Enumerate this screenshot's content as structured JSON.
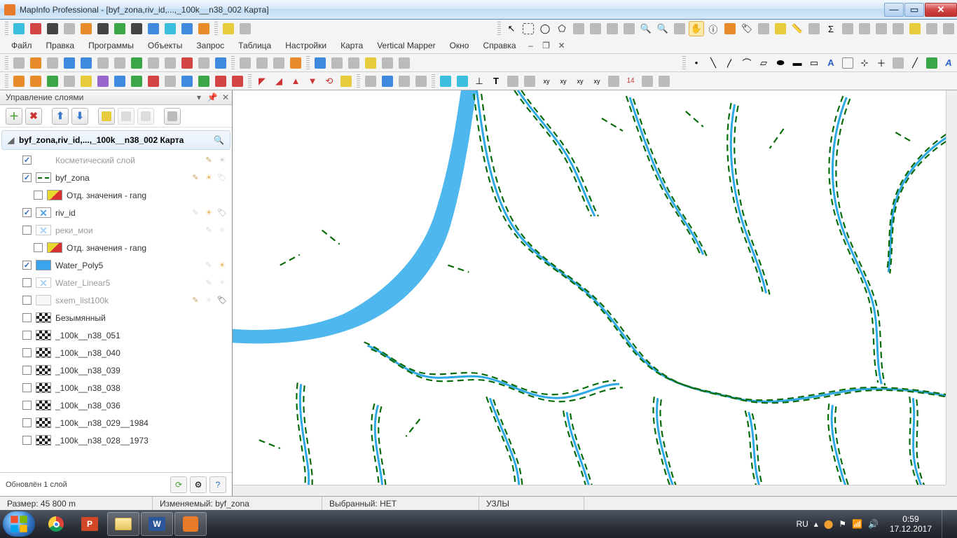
{
  "title": "MapInfo Professional - [byf_zona,riv_id,...,_100k__n38_002 Карта]",
  "menu": [
    "Файл",
    "Правка",
    "Программы",
    "Объекты",
    "Запрос",
    "Таблица",
    "Настройки",
    "Карта",
    "Vertical Mapper",
    "Окно",
    "Справка"
  ],
  "panel": {
    "title": "Управление слоями",
    "root": "byf_zona,riv_id,...,_100k__n38_002 Карта",
    "foot": "Обновлён 1 слой"
  },
  "layers": [
    {
      "chk": true,
      "disabled": true,
      "symType": "none",
      "name": "Косметический слой",
      "edit": true,
      "sun": true
    },
    {
      "chk": true,
      "symType": "dash",
      "name": "byf_zona",
      "edit": true,
      "sun": true,
      "sunOrange": true,
      "tag": false
    },
    {
      "chk": false,
      "sub": true,
      "symType": "grad",
      "name": "Отд. значения - rang"
    },
    {
      "chk": true,
      "symType": "x",
      "name": "riv_id",
      "edit": false,
      "sun": true,
      "tag": true,
      "sunOrange": true
    },
    {
      "chk": false,
      "disabled": true,
      "symType": "x",
      "name": "реки_мои",
      "edit": false,
      "sun": false
    },
    {
      "chk": false,
      "sub": true,
      "symType": "grad",
      "name": "Отд. значения - rang"
    },
    {
      "chk": true,
      "symType": "poly",
      "name": "Water_Poly5",
      "edit": false,
      "sun": true,
      "sunOrange": true
    },
    {
      "chk": false,
      "disabled": true,
      "symType": "x",
      "name": "Water_Linear5",
      "edit": false,
      "sun": false
    },
    {
      "chk": false,
      "disabled": true,
      "symType": "none-box",
      "name": "sxem_list100k",
      "edit": true,
      "sun": false,
      "tag": true,
      "tagOrange": true
    },
    {
      "chk": false,
      "symType": "chk",
      "name": "Безымянный"
    },
    {
      "chk": false,
      "symType": "chk",
      "name": "_100k__n38_051"
    },
    {
      "chk": false,
      "symType": "chk",
      "name": "_100k__n38_040"
    },
    {
      "chk": false,
      "symType": "chk",
      "name": "_100k__n38_039"
    },
    {
      "chk": false,
      "symType": "chk",
      "name": "_100k__n38_038"
    },
    {
      "chk": false,
      "symType": "chk",
      "name": "_100k__n38_036"
    },
    {
      "chk": false,
      "symType": "chk",
      "name": "_100k__n38_029__1984"
    },
    {
      "chk": false,
      "symType": "chk",
      "name": "_100k__n38_028__1973"
    }
  ],
  "status": {
    "size": "Размер: 45 800 m",
    "edit": "Изменяемый: byf_zona",
    "sel": "Выбранный: НЕТ",
    "nodes": "УЗЛЫ"
  },
  "tray": {
    "lang": "RU",
    "time": "0:59",
    "date": "17.12.2017"
  }
}
